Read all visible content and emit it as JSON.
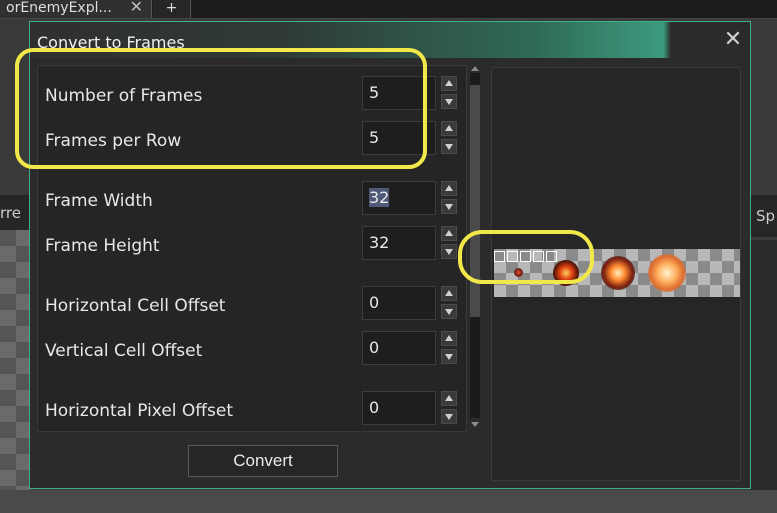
{
  "tabs": {
    "active_label": "orEnemyExpl...",
    "close_glyph": "✕",
    "add_glyph": "+"
  },
  "background": {
    "left_strip_text": "rre",
    "right_strip_text": "Sp"
  },
  "dialog": {
    "title": "Convert to Frames",
    "close_glyph": "✕",
    "fields": [
      {
        "label": "Number of Frames",
        "value": "5"
      },
      {
        "label": "Frames per Row",
        "value": "5"
      },
      {
        "label": "Frame Width",
        "value": "32"
      },
      {
        "label": "Frame Height",
        "value": "32"
      },
      {
        "label": "Horizontal Cell Offset",
        "value": "0"
      },
      {
        "label": "Vertical Cell Offset",
        "value": "0"
      },
      {
        "label": "Horizontal Pixel Offset",
        "value": "0"
      }
    ],
    "convert_label": "Convert"
  },
  "colors": {
    "accent": "#3fae8c",
    "highlight": "#f2e84a"
  }
}
